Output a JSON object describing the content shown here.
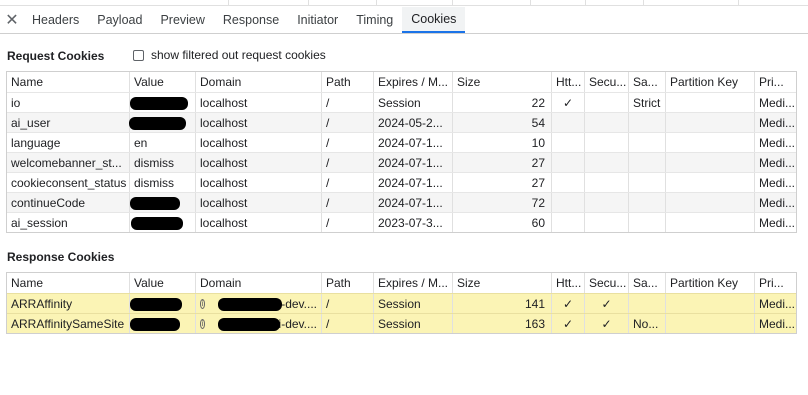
{
  "tabs": {
    "close_glyph": "✕",
    "items": [
      "Headers",
      "Payload",
      "Preview",
      "Response",
      "Initiator",
      "Timing",
      "Cookies"
    ],
    "active": "Cookies"
  },
  "request_section": {
    "title": "Request Cookies",
    "filter_label": "show filtered out request cookies"
  },
  "response_section": {
    "title": "Response Cookies"
  },
  "columns": [
    "Name",
    "Value",
    "Domain",
    "Path",
    "Expires / M...",
    "Size",
    "Htt...",
    "Secu...",
    "Sa...",
    "Partition Key",
    "Pri..."
  ],
  "request_rows": [
    {
      "name": "io",
      "value": "",
      "domain": "localhost",
      "path": "/",
      "expires": "Session",
      "size": "22",
      "http": "✓",
      "secure": "",
      "same": "Strict",
      "pkey": "",
      "pri": "Medi..."
    },
    {
      "name": "ai_user",
      "value": "",
      "domain": "localhost",
      "path": "/",
      "expires": "2024-05-2...",
      "size": "54",
      "http": "",
      "secure": "",
      "same": "",
      "pkey": "",
      "pri": "Medi..."
    },
    {
      "name": "language",
      "value": "en",
      "domain": "localhost",
      "path": "/",
      "expires": "2024-07-1...",
      "size": "10",
      "http": "",
      "secure": "",
      "same": "",
      "pkey": "",
      "pri": "Medi..."
    },
    {
      "name": "welcomebanner_st...",
      "value": "dismiss",
      "domain": "localhost",
      "path": "/",
      "expires": "2024-07-1...",
      "size": "27",
      "http": "",
      "secure": "",
      "same": "",
      "pkey": "",
      "pri": "Medi..."
    },
    {
      "name": "cookieconsent_status",
      "value": "dismiss",
      "domain": "localhost",
      "path": "/",
      "expires": "2024-07-1...",
      "size": "27",
      "http": "",
      "secure": "",
      "same": "",
      "pkey": "",
      "pri": "Medi..."
    },
    {
      "name": "continueCode",
      "value": "",
      "domain": "localhost",
      "path": "/",
      "expires": "2024-07-1...",
      "size": "72",
      "http": "",
      "secure": "",
      "same": "",
      "pkey": "",
      "pri": "Medi..."
    },
    {
      "name": "ai_session",
      "value": "",
      "domain": "localhost",
      "path": "/",
      "expires": "2023-07-3...",
      "size": "60",
      "http": "",
      "secure": "",
      "same": "",
      "pkey": "",
      "pri": "Medi..."
    }
  ],
  "response_rows": [
    {
      "name": "ARRAffinity",
      "value": "",
      "domain": "api-dev....",
      "path": "/",
      "expires": "Session",
      "size": "141",
      "http": "✓",
      "secure": "✓",
      "same": "",
      "pkey": "",
      "pri": "Medi..."
    },
    {
      "name": "ARRAffinitySameSite",
      "value": "",
      "domain": "api-dev....",
      "path": "/",
      "expires": "Session",
      "size": "163",
      "http": "✓",
      "secure": "✓",
      "same": "No...",
      "pkey": "",
      "pri": "Medi..."
    }
  ],
  "colors": {
    "active_tab_underline": "#1a73e8",
    "highlight_row": "#fbf4b5",
    "alt_row": "#f5f5f5"
  }
}
